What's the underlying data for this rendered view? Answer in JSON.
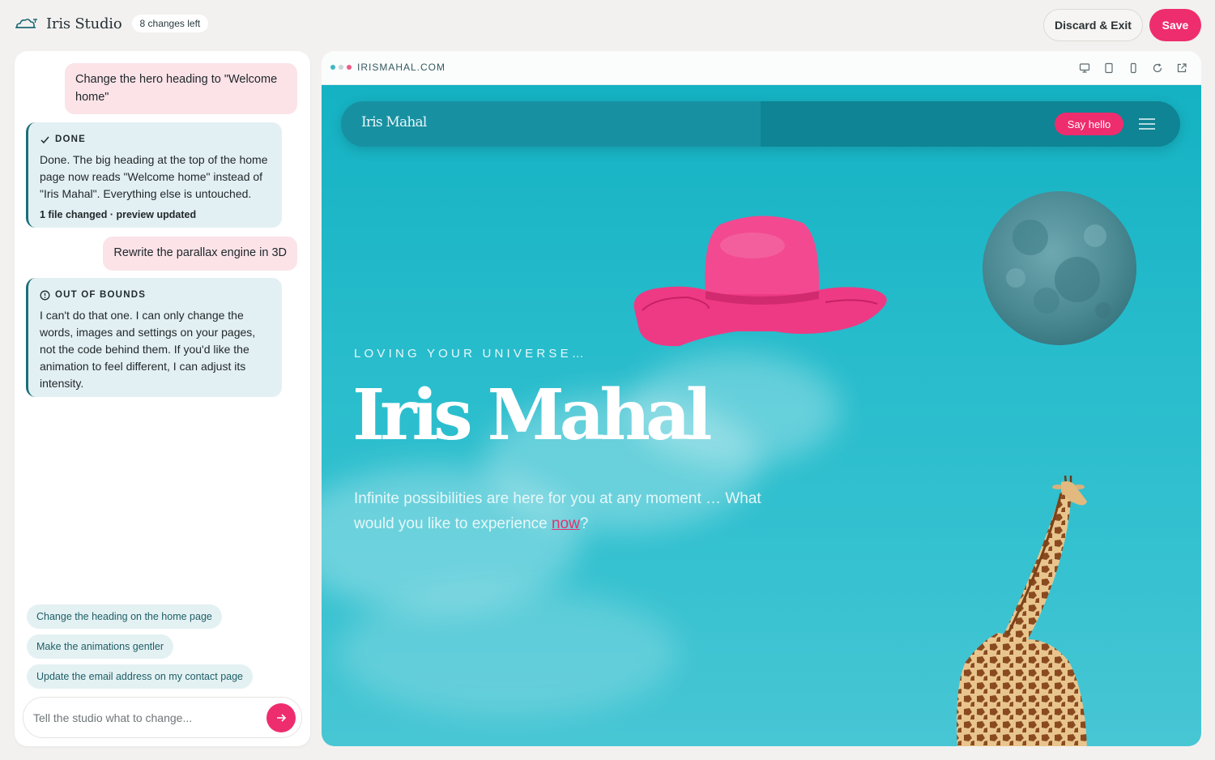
{
  "app": {
    "name": "Iris Studio",
    "changes_badge": "8 changes left",
    "discard_label": "Discard & Exit",
    "save_label": "Save",
    "accent": "#ee2d6e"
  },
  "chat": {
    "messages": [
      {
        "role": "user",
        "text": "Change the hero heading to \"Welcome home\""
      },
      {
        "role": "assistant",
        "status_icon": "check-icon",
        "status": "DONE",
        "text": "Done. The big heading at the top of the home page now reads \"Welcome home\" instead of \"Iris Mahal\". Everything else is untouched.",
        "footer": "1 file changed · preview updated"
      },
      {
        "role": "user",
        "text": "Rewrite the parallax engine in 3D"
      },
      {
        "role": "assistant",
        "status_icon": "out-of-bounds-icon",
        "status": "OUT OF BOUNDS",
        "text": "I can't do that one. I can only change the words, images and settings on your pages, not the code behind them. If you'd like the animation to feel different, I can adjust its intensity."
      }
    ],
    "suggestions": [
      "Change the heading on the home page",
      "Make the animations gentler",
      "Update the email address on my contact page"
    ],
    "input_placeholder": "Tell the studio what to change...",
    "input_value": ""
  },
  "preview": {
    "url": "IRISMAHAL.COM",
    "toolbar_icons": [
      "desktop-icon",
      "tablet-icon",
      "mobile-icon",
      "refresh-icon",
      "open-external-icon"
    ],
    "site": {
      "logo": "Iris Mahal",
      "cta": "Say hello",
      "eyebrow": "LOVING YOUR UNIVERSE…",
      "heading": "Iris Mahal",
      "subtitle_before": "Infinite possibilities are here for you at any moment … What would you like to experience ",
      "subtitle_link": "now",
      "subtitle_after": "?",
      "images": [
        "pink-sun-hat",
        "moon",
        "giraffe"
      ]
    }
  }
}
